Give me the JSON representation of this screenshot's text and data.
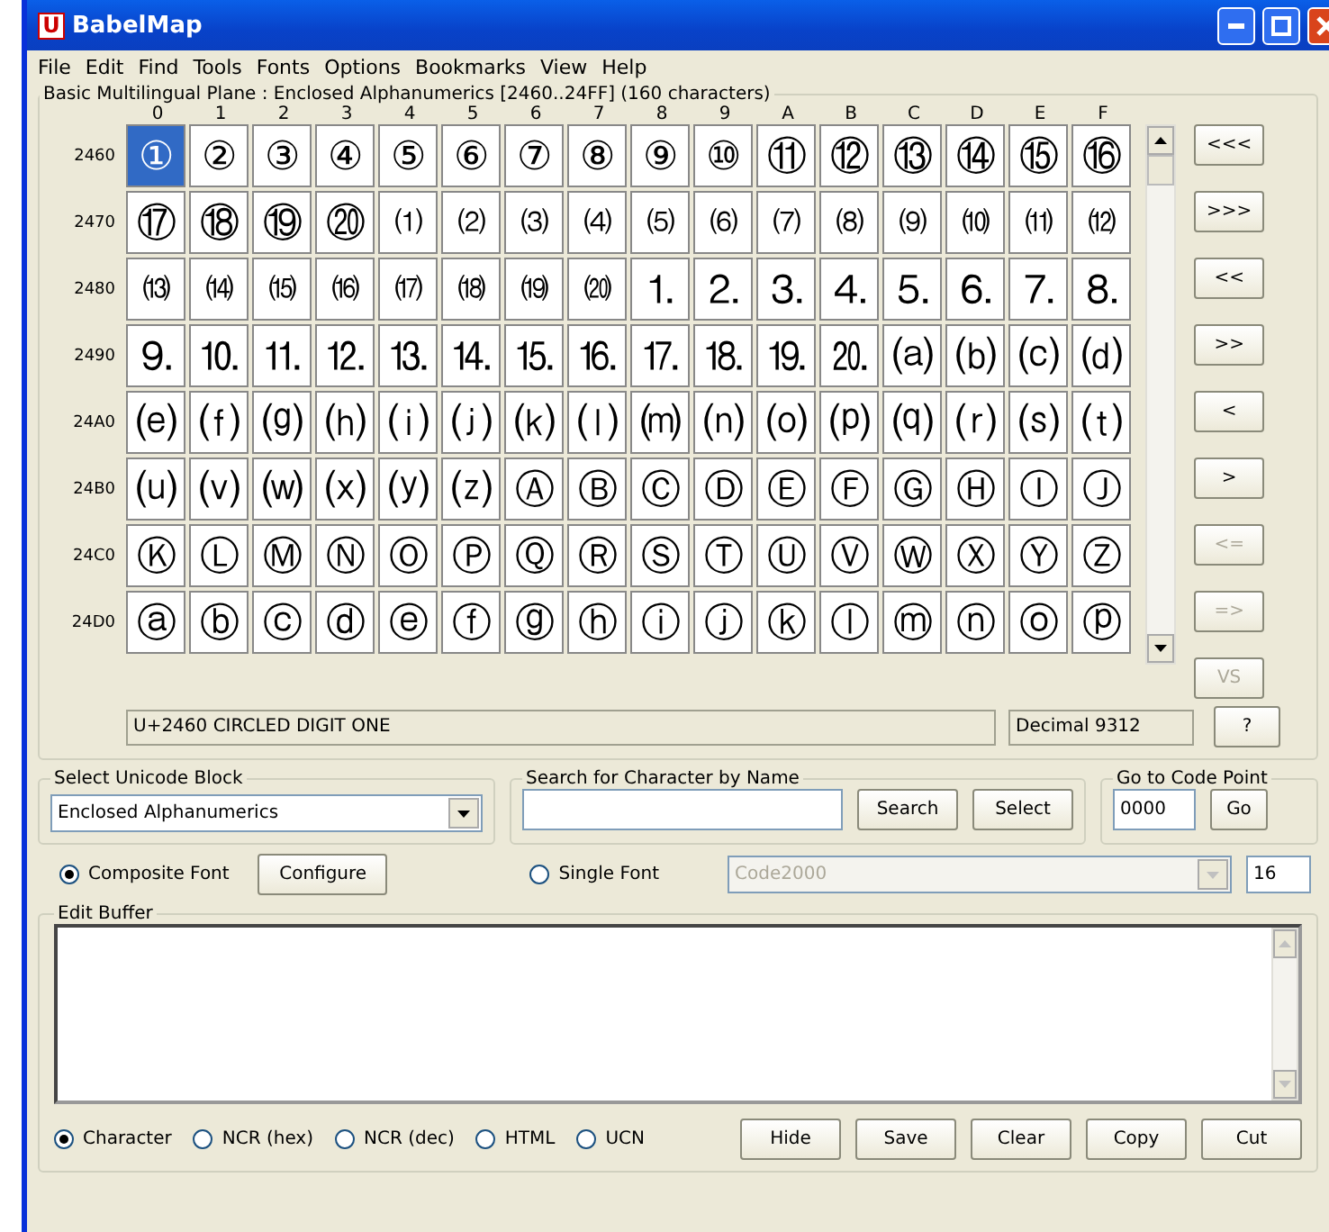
{
  "window": {
    "title": "BabelMap",
    "app_icon": "U"
  },
  "menu": [
    "File",
    "Edit",
    "Find",
    "Tools",
    "Fonts",
    "Options",
    "Bookmarks",
    "View",
    "Help"
  ],
  "grid": {
    "title": "Basic Multilingual Plane : Enclosed Alphanumerics [2460..24FF] (160 characters)",
    "columns": [
      "0",
      "1",
      "2",
      "3",
      "4",
      "5",
      "6",
      "7",
      "8",
      "9",
      "A",
      "B",
      "C",
      "D",
      "E",
      "F"
    ],
    "rows": [
      {
        "label": "2460",
        "cells": [
          {
            "char": "①",
            "selected": true
          },
          {
            "char": "②",
            "selected": false
          },
          {
            "char": "③",
            "selected": false
          },
          {
            "char": "④",
            "selected": false
          },
          {
            "char": "⑤",
            "selected": false
          },
          {
            "char": "⑥",
            "selected": false
          },
          {
            "char": "⑦",
            "selected": false
          },
          {
            "char": "⑧",
            "selected": false
          },
          {
            "char": "⑨",
            "selected": false
          },
          {
            "char": "⑩",
            "selected": false
          },
          {
            "char": "⑪",
            "selected": false
          },
          {
            "char": "⑫",
            "selected": false
          },
          {
            "char": "⑬",
            "selected": false
          },
          {
            "char": "⑭",
            "selected": false
          },
          {
            "char": "⑮",
            "selected": false
          },
          {
            "char": "⑯",
            "selected": false
          }
        ]
      },
      {
        "label": "2470",
        "cells": [
          {
            "char": "⑰",
            "selected": false
          },
          {
            "char": "⑱",
            "selected": false
          },
          {
            "char": "⑲",
            "selected": false
          },
          {
            "char": "⑳",
            "selected": false
          },
          {
            "char": "⑴",
            "selected": false
          },
          {
            "char": "⑵",
            "selected": false
          },
          {
            "char": "⑶",
            "selected": false
          },
          {
            "char": "⑷",
            "selected": false
          },
          {
            "char": "⑸",
            "selected": false
          },
          {
            "char": "⑹",
            "selected": false
          },
          {
            "char": "⑺",
            "selected": false
          },
          {
            "char": "⑻",
            "selected": false
          },
          {
            "char": "⑼",
            "selected": false
          },
          {
            "char": "⑽",
            "selected": false
          },
          {
            "char": "⑾",
            "selected": false
          },
          {
            "char": "⑿",
            "selected": false
          }
        ]
      },
      {
        "label": "2480",
        "cells": [
          {
            "char": "⒀",
            "selected": false
          },
          {
            "char": "⒁",
            "selected": false
          },
          {
            "char": "⒂",
            "selected": false
          },
          {
            "char": "⒃",
            "selected": false
          },
          {
            "char": "⒄",
            "selected": false
          },
          {
            "char": "⒅",
            "selected": false
          },
          {
            "char": "⒆",
            "selected": false
          },
          {
            "char": "⒇",
            "selected": false
          },
          {
            "char": "⒈",
            "selected": false
          },
          {
            "char": "⒉",
            "selected": false
          },
          {
            "char": "⒊",
            "selected": false
          },
          {
            "char": "⒋",
            "selected": false
          },
          {
            "char": "⒌",
            "selected": false
          },
          {
            "char": "⒍",
            "selected": false
          },
          {
            "char": "⒎",
            "selected": false
          },
          {
            "char": "⒏",
            "selected": false
          }
        ]
      },
      {
        "label": "2490",
        "cells": [
          {
            "char": "⒐",
            "selected": false
          },
          {
            "char": "⒑",
            "selected": false
          },
          {
            "char": "⒒",
            "selected": false
          },
          {
            "char": "⒓",
            "selected": false
          },
          {
            "char": "⒔",
            "selected": false
          },
          {
            "char": "⒕",
            "selected": false
          },
          {
            "char": "⒖",
            "selected": false
          },
          {
            "char": "⒗",
            "selected": false
          },
          {
            "char": "⒘",
            "selected": false
          },
          {
            "char": "⒙",
            "selected": false
          },
          {
            "char": "⒚",
            "selected": false
          },
          {
            "char": "⒛",
            "selected": false
          },
          {
            "char": "⒜",
            "selected": false
          },
          {
            "char": "⒝",
            "selected": false
          },
          {
            "char": "⒞",
            "selected": false
          },
          {
            "char": "⒟",
            "selected": false
          }
        ]
      },
      {
        "label": "24A0",
        "cells": [
          {
            "char": "⒠",
            "selected": false
          },
          {
            "char": "⒡",
            "selected": false
          },
          {
            "char": "⒢",
            "selected": false
          },
          {
            "char": "⒣",
            "selected": false
          },
          {
            "char": "⒤",
            "selected": false
          },
          {
            "char": "⒥",
            "selected": false
          },
          {
            "char": "⒦",
            "selected": false
          },
          {
            "char": "⒧",
            "selected": false
          },
          {
            "char": "⒨",
            "selected": false
          },
          {
            "char": "⒩",
            "selected": false
          },
          {
            "char": "⒪",
            "selected": false
          },
          {
            "char": "⒫",
            "selected": false
          },
          {
            "char": "⒬",
            "selected": false
          },
          {
            "char": "⒭",
            "selected": false
          },
          {
            "char": "⒮",
            "selected": false
          },
          {
            "char": "⒯",
            "selected": false
          }
        ]
      },
      {
        "label": "24B0",
        "cells": [
          {
            "char": "⒰",
            "selected": false
          },
          {
            "char": "⒱",
            "selected": false
          },
          {
            "char": "⒲",
            "selected": false
          },
          {
            "char": "⒳",
            "selected": false
          },
          {
            "char": "⒴",
            "selected": false
          },
          {
            "char": "⒵",
            "selected": false
          },
          {
            "char": "Ⓐ",
            "selected": false
          },
          {
            "char": "Ⓑ",
            "selected": false
          },
          {
            "char": "Ⓒ",
            "selected": false
          },
          {
            "char": "Ⓓ",
            "selected": false
          },
          {
            "char": "Ⓔ",
            "selected": false
          },
          {
            "char": "Ⓕ",
            "selected": false
          },
          {
            "char": "Ⓖ",
            "selected": false
          },
          {
            "char": "Ⓗ",
            "selected": false
          },
          {
            "char": "Ⓘ",
            "selected": false
          },
          {
            "char": "Ⓙ",
            "selected": false
          }
        ]
      },
      {
        "label": "24C0",
        "cells": [
          {
            "char": "Ⓚ",
            "selected": false
          },
          {
            "char": "Ⓛ",
            "selected": false
          },
          {
            "char": "Ⓜ",
            "selected": false
          },
          {
            "char": "Ⓝ",
            "selected": false
          },
          {
            "char": "Ⓞ",
            "selected": false
          },
          {
            "char": "Ⓟ",
            "selected": false
          },
          {
            "char": "Ⓠ",
            "selected": false
          },
          {
            "char": "Ⓡ",
            "selected": false
          },
          {
            "char": "Ⓢ",
            "selected": false
          },
          {
            "char": "Ⓣ",
            "selected": false
          },
          {
            "char": "Ⓤ",
            "selected": false
          },
          {
            "char": "Ⓥ",
            "selected": false
          },
          {
            "char": "Ⓦ",
            "selected": false
          },
          {
            "char": "Ⓧ",
            "selected": false
          },
          {
            "char": "Ⓨ",
            "selected": false
          },
          {
            "char": "Ⓩ",
            "selected": false
          }
        ]
      },
      {
        "label": "24D0",
        "cells": [
          {
            "char": "ⓐ",
            "selected": false
          },
          {
            "char": "ⓑ",
            "selected": false
          },
          {
            "char": "ⓒ",
            "selected": false
          },
          {
            "char": "ⓓ",
            "selected": false
          },
          {
            "char": "ⓔ",
            "selected": false
          },
          {
            "char": "ⓕ",
            "selected": false
          },
          {
            "char": "ⓖ",
            "selected": false
          },
          {
            "char": "ⓗ",
            "selected": false
          },
          {
            "char": "ⓘ",
            "selected": false
          },
          {
            "char": "ⓙ",
            "selected": false
          },
          {
            "char": "ⓚ",
            "selected": false
          },
          {
            "char": "ⓛ",
            "selected": false
          },
          {
            "char": "ⓜ",
            "selected": false
          },
          {
            "char": "ⓝ",
            "selected": false
          },
          {
            "char": "ⓞ",
            "selected": false
          },
          {
            "char": "ⓟ",
            "selected": false
          }
        ]
      }
    ],
    "nav_buttons": [
      {
        "label": "<<<",
        "disabled": false
      },
      {
        "label": ">>>",
        "disabled": false
      },
      {
        "label": "<<",
        "disabled": false
      },
      {
        "label": ">>",
        "disabled": false
      },
      {
        "label": "<",
        "disabled": false
      },
      {
        "label": ">",
        "disabled": false
      },
      {
        "label": "<=",
        "disabled": true
      },
      {
        "label": "=>",
        "disabled": true
      },
      {
        "label": "VS",
        "disabled": true
      }
    ],
    "character_name": "U+2460 CIRCLED DIGIT ONE",
    "decimal": "Decimal 9312",
    "help_button": "?"
  },
  "select_block": {
    "title": "Select Unicode Block",
    "value": "Enclosed Alphanumerics"
  },
  "search": {
    "title": "Search for Character by Name",
    "buttons": [
      "Search",
      "Select"
    ]
  },
  "goto": {
    "title": "Go to Code Point",
    "value": "0000",
    "button": "Go"
  },
  "font": {
    "options": [
      {
        "label": "Composite Font",
        "selected": true
      },
      {
        "label": "Single Font",
        "selected": false
      }
    ],
    "configure": "Configure",
    "single_font": "Code2000",
    "size": "16"
  },
  "edit_buffer": {
    "title": "Edit Buffer",
    "formats": [
      {
        "label": "Character",
        "selected": true
      },
      {
        "label": "NCR (hex)",
        "selected": false
      },
      {
        "label": "NCR (dec)",
        "selected": false
      },
      {
        "label": "HTML",
        "selected": false
      },
      {
        "label": "UCN",
        "selected": false
      }
    ],
    "buttons": [
      "Hide",
      "Save",
      "Clear",
      "Copy",
      "Cut"
    ]
  }
}
